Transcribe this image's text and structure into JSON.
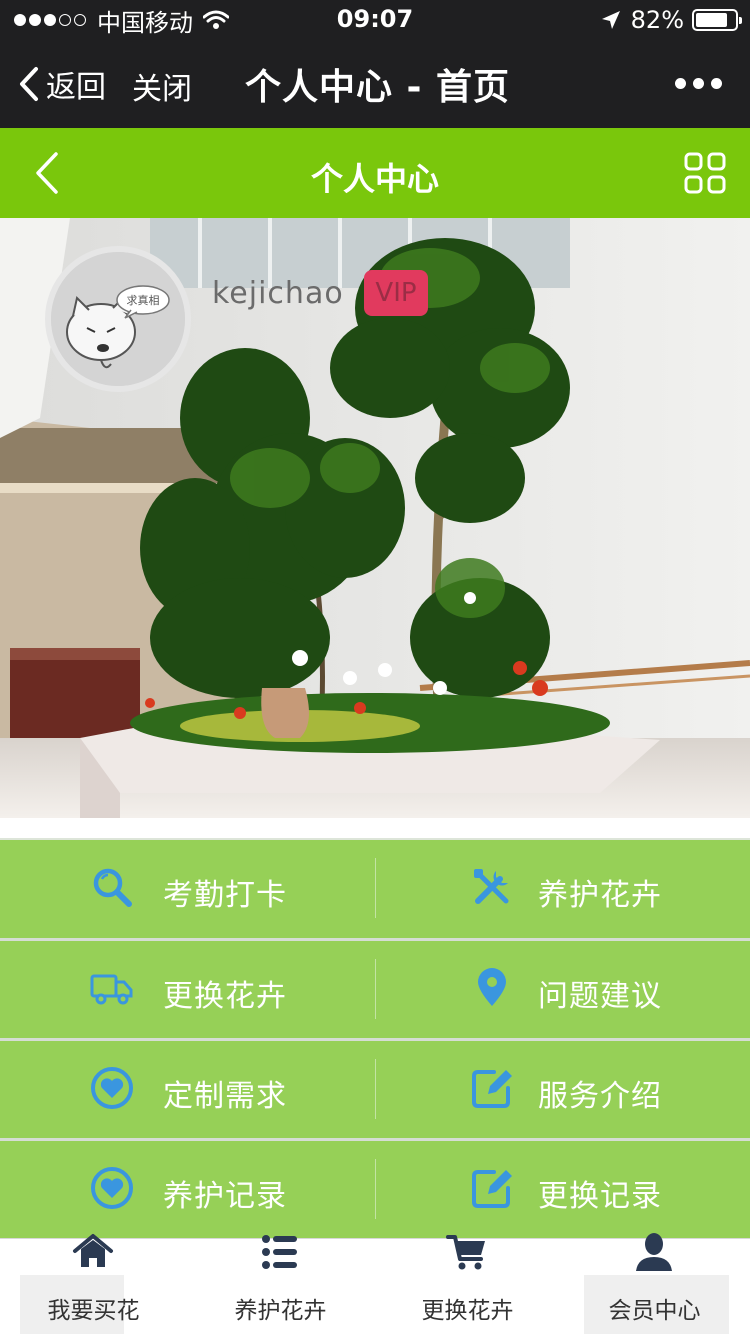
{
  "status_bar": {
    "carrier": "中国移动",
    "time": "09:07",
    "battery": "82%",
    "battery_level": 0.82,
    "signal_bars_filled": 3,
    "signal_bars_total": 5
  },
  "wechat_nav": {
    "back_label": "返回",
    "close_label": "关闭",
    "title": "个人中心 - 首页"
  },
  "page_header": {
    "title": "个人中心",
    "accent_color": "#7ac70c"
  },
  "profile": {
    "avatar_caption": "求真相",
    "username": "kejichao",
    "badge": "VIP"
  },
  "menu": {
    "rows": [
      {
        "left": {
          "label": "考勤打卡",
          "icon": "search-icon"
        },
        "right": {
          "label": "养护花卉",
          "icon": "tools-icon"
        }
      },
      {
        "left": {
          "label": "更换花卉",
          "icon": "truck-icon"
        },
        "right": {
          "label": "问题建议",
          "icon": "map-pin-icon"
        }
      },
      {
        "left": {
          "label": "定制需求",
          "icon": "heart-icon"
        },
        "right": {
          "label": "服务介绍",
          "icon": "edit-icon"
        }
      },
      {
        "left": {
          "label": "养护记录",
          "icon": "heart-icon"
        },
        "right": {
          "label": "更换记录",
          "icon": "edit-icon"
        }
      }
    ],
    "tile_color": "#96d057",
    "icon_color": "#3a96df"
  },
  "tabbar": {
    "tabs": [
      {
        "label": "我要买花",
        "icon": "home-icon"
      },
      {
        "label": "养护花卉",
        "icon": "list-icon"
      },
      {
        "label": "更换花卉",
        "icon": "cart-icon"
      },
      {
        "label": "会员中心",
        "icon": "user-icon"
      }
    ],
    "icon_color": "#2b3a52"
  }
}
